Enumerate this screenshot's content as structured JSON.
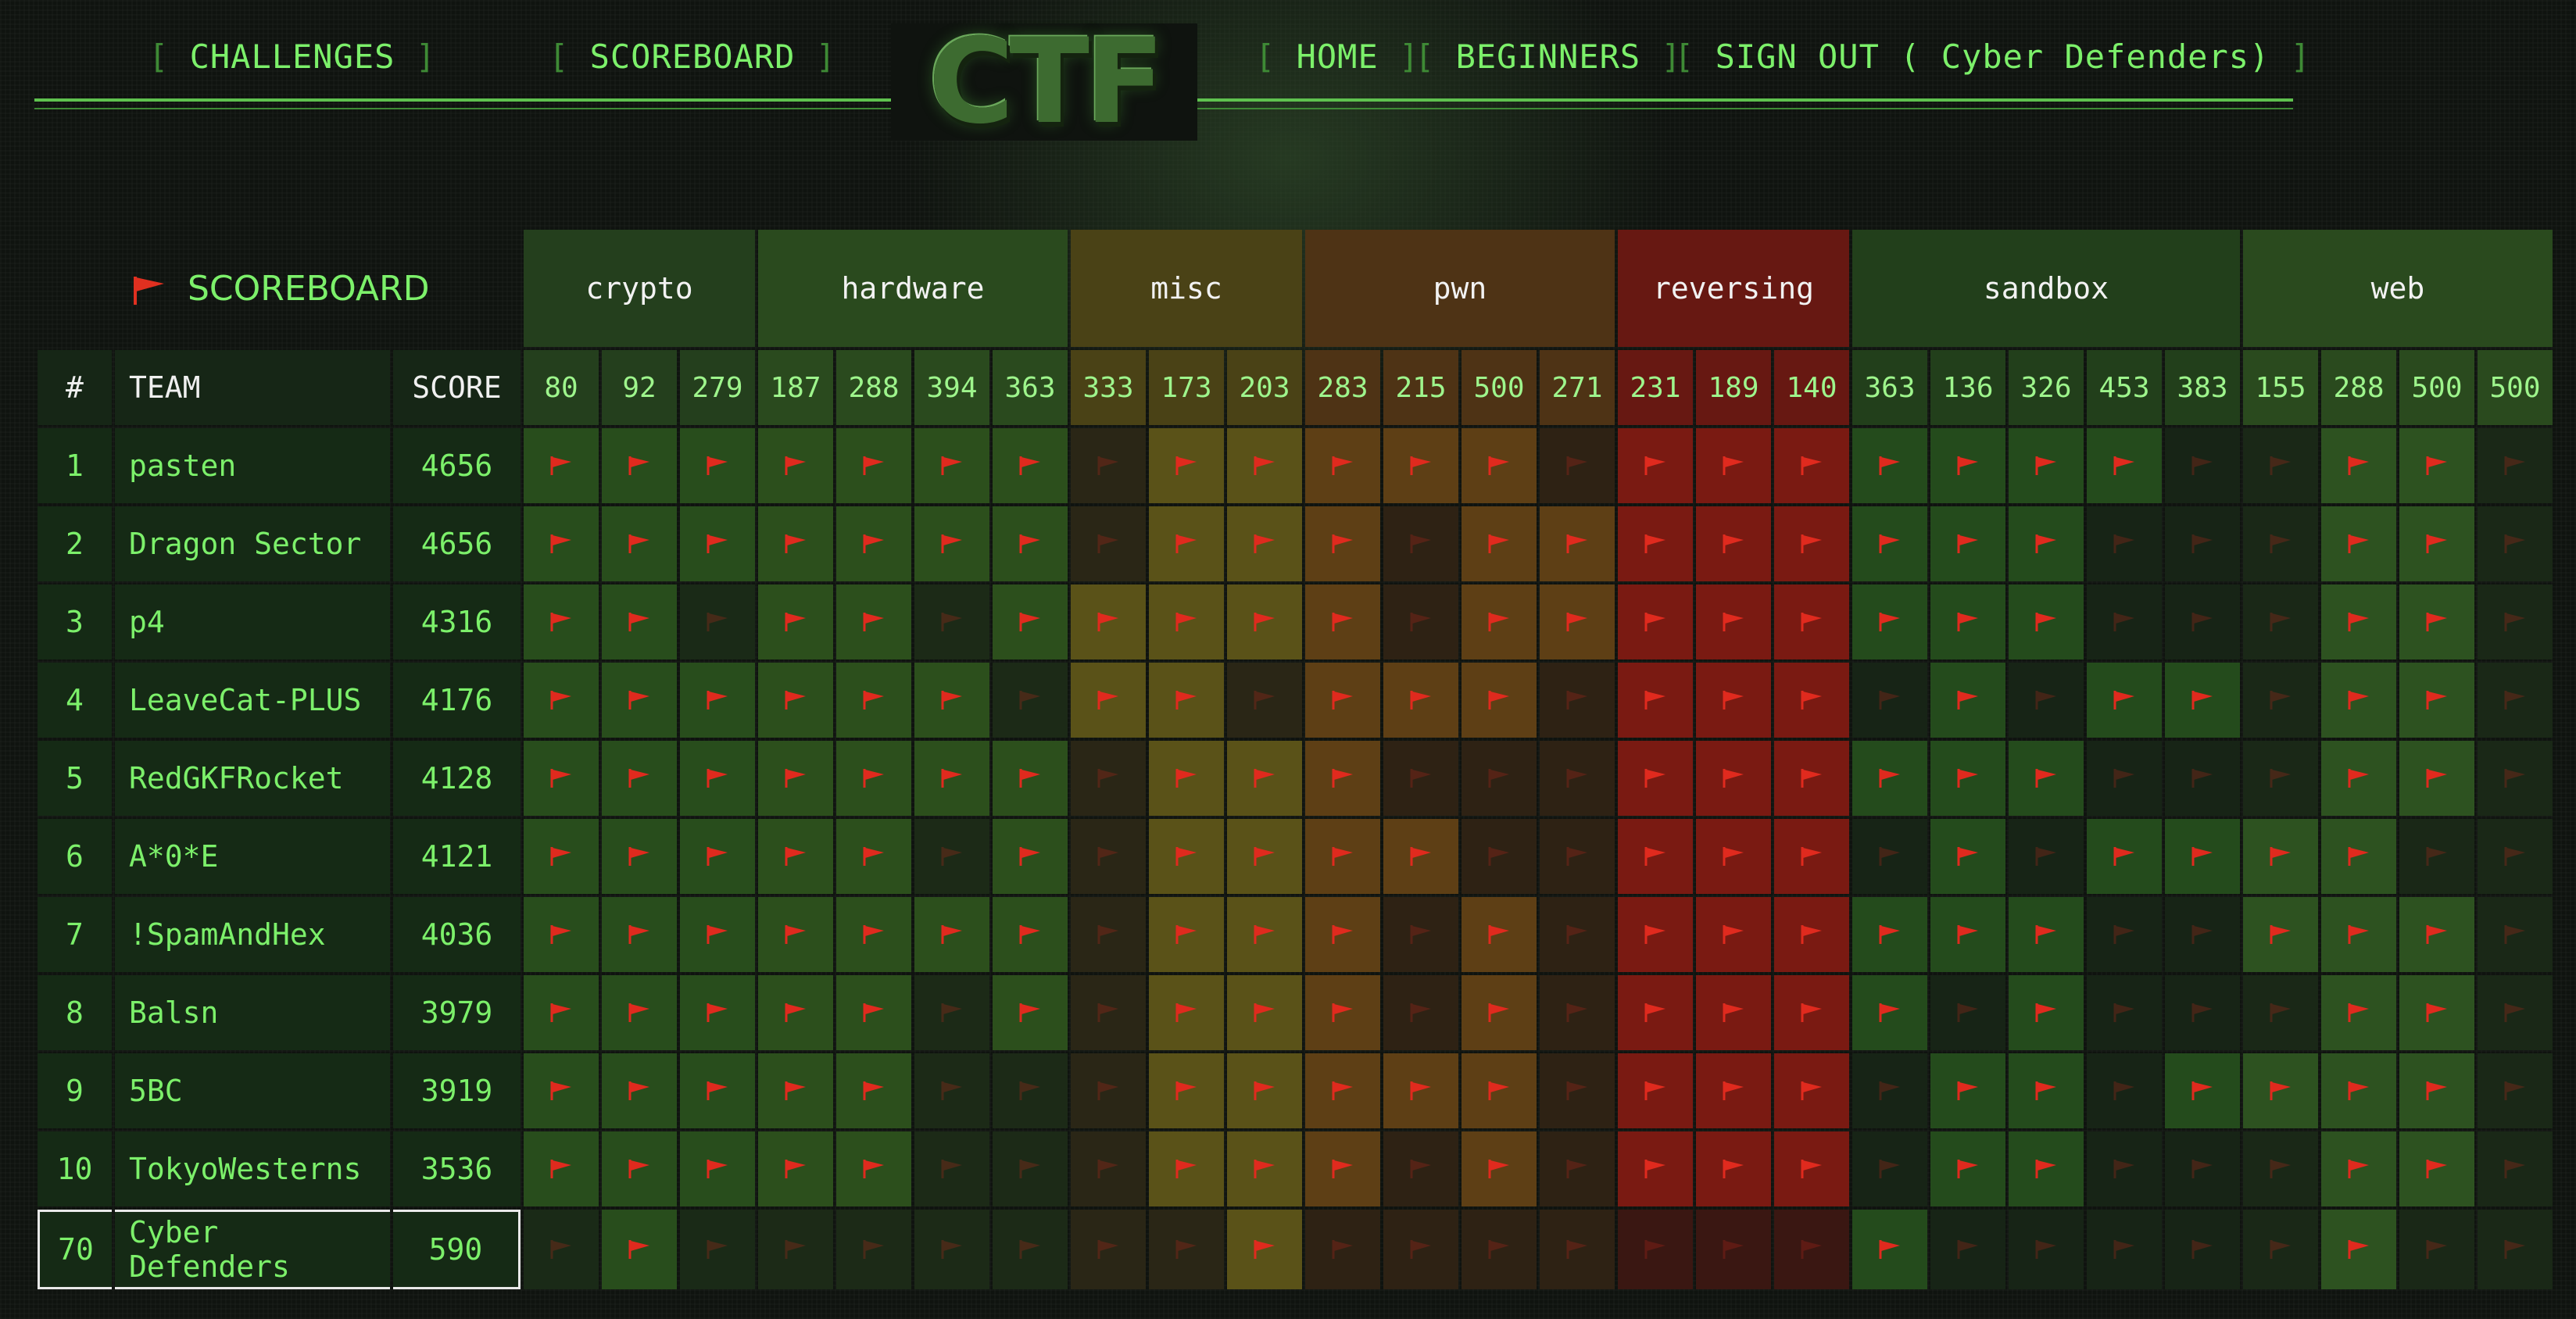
{
  "nav": {
    "challenges": "CHALLENGES",
    "scoreboard": "SCOREBOARD",
    "home": "HOME",
    "beginners": "BEGINNERS",
    "signout": "SIGN OUT ( Cyber Defenders)",
    "bracket_open": "[",
    "bracket_close": "]",
    "logo": "CTF"
  },
  "scoreboard": {
    "title": "SCOREBOARD",
    "headers": {
      "rank": "#",
      "team": "TEAM",
      "score": "SCORE"
    },
    "categories": [
      {
        "name": "crypto",
        "solved_bg": "#284d1c",
        "unsolved_bg": "#1a2a17",
        "cat_bg": "#243f1d",
        "points": [
          80,
          92,
          279
        ]
      },
      {
        "name": "hardware",
        "solved_bg": "#2c4f1c",
        "unsolved_bg": "#1c2a17",
        "cat_bg": "#2a4a1e",
        "points": [
          187,
          288,
          394,
          363
        ]
      },
      {
        "name": "misc",
        "solved_bg": "#5a5218",
        "unsolved_bg": "#2a2616",
        "cat_bg": "#4a4216",
        "points": [
          333,
          173,
          203
        ]
      },
      {
        "name": "pwn",
        "solved_bg": "#5e3f15",
        "unsolved_bg": "#2e2214",
        "cat_bg": "#4e3315",
        "points": [
          283,
          215,
          500,
          271
        ]
      },
      {
        "name": "reversing",
        "solved_bg": "#7a1a12",
        "unsolved_bg": "#3a1712",
        "cat_bg": "#671812",
        "points": [
          231,
          189,
          140
        ]
      },
      {
        "name": "sandbox",
        "solved_bg": "#244b1c",
        "unsolved_bg": "#172416",
        "cat_bg": "#223f1b",
        "points": [
          363,
          136,
          326,
          453,
          383
        ]
      },
      {
        "name": "web",
        "solved_bg": "#2d5220",
        "unsolved_bg": "#1a2817",
        "cat_bg": "#2a4a1e",
        "points": [
          155,
          288,
          500,
          500
        ]
      }
    ],
    "rows": [
      {
        "rank": "1",
        "team": "pasten",
        "score": "4656",
        "solved": "1111111011111011111110011000"
      },
      {
        "rank": "2",
        "team": "Dragon Sector",
        "score": "4656",
        "solved": "1111111011101111111100011000"
      },
      {
        "rank": "3",
        "team": "p4",
        "score": "4316",
        "solved": "1101101111101111111100011000"
      },
      {
        "rank": "4",
        "team": "LeaveCat-PLUS",
        "score": "4176",
        "solved": "1111110110111011101011011000"
      },
      {
        "rank": "5",
        "team": "RedGKFRocket",
        "score": "4128",
        "solved": "1111111011100011111100011000"
      },
      {
        "rank": "6",
        "team": "A*0*E",
        "score": "4121",
        "solved": "1111101011110011101011110000"
      },
      {
        "rank": "7",
        "team": "!SpamAndHex",
        "score": "4036",
        "solved": "1111111011101011111100111000"
      },
      {
        "rank": "8",
        "team": "Balsn",
        "score": "3979",
        "solved": "1111101011101011110100011000"
      },
      {
        "rank": "9",
        "team": "5BC",
        "score": "3919",
        "solved": "1111100011111011101101111000"
      },
      {
        "rank": "10",
        "team": "TokyoWesterns",
        "score": "3536",
        "solved": "1111100011101011101100011000"
      },
      {
        "rank": "70",
        "team": "Cyber Defenders",
        "score": "590",
        "solved": "0100000001000000010000010000",
        "highlight": true
      }
    ]
  }
}
